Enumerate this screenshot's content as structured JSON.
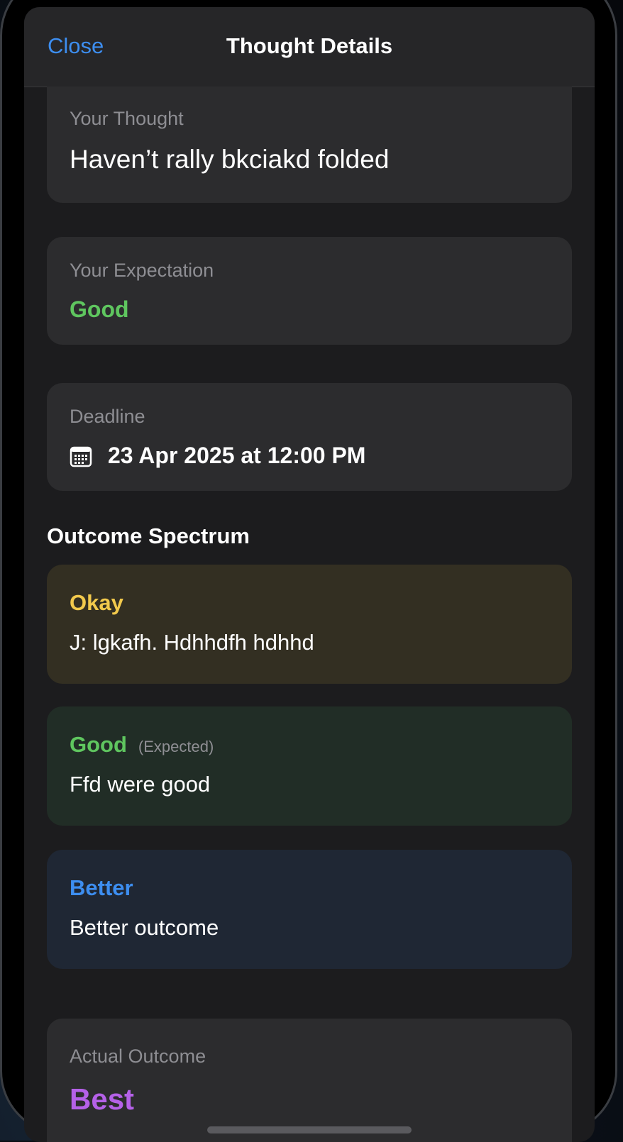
{
  "nav": {
    "close_label": "Close",
    "title": "Thought Details"
  },
  "thought": {
    "label": "Your Thought",
    "value": "Haven’t rally bkciakd folded"
  },
  "expectation": {
    "label": "Your Expectation",
    "value": "Good",
    "color": "#5fc65f"
  },
  "deadline": {
    "label": "Deadline",
    "icon": "calendar-icon",
    "value": "23 Apr 2025 at 12:00 PM"
  },
  "outcome_spectrum": {
    "title": "Outcome Spectrum",
    "items": [
      {
        "title": "Okay",
        "badge": "",
        "description": "J: lgkafh. Hdhhdfh hdhhd",
        "title_color": "#f2c94c",
        "bg_color": "#332f22"
      },
      {
        "title": "Good",
        "badge": "(Expected)",
        "description": "Ffd were good",
        "title_color": "#5fc65f",
        "bg_color": "#212d26"
      },
      {
        "title": "Better",
        "badge": "",
        "description": "Better outcome",
        "title_color": "#3d8ef0",
        "bg_color": "#1f2734"
      }
    ]
  },
  "actual": {
    "label": "Actual Outcome",
    "value": "Best",
    "color": "#b561e8"
  },
  "colors": {
    "accent": "#3d8ef0",
    "sheet_bg": "#1c1c1e",
    "card_bg": "#2c2c2e"
  }
}
